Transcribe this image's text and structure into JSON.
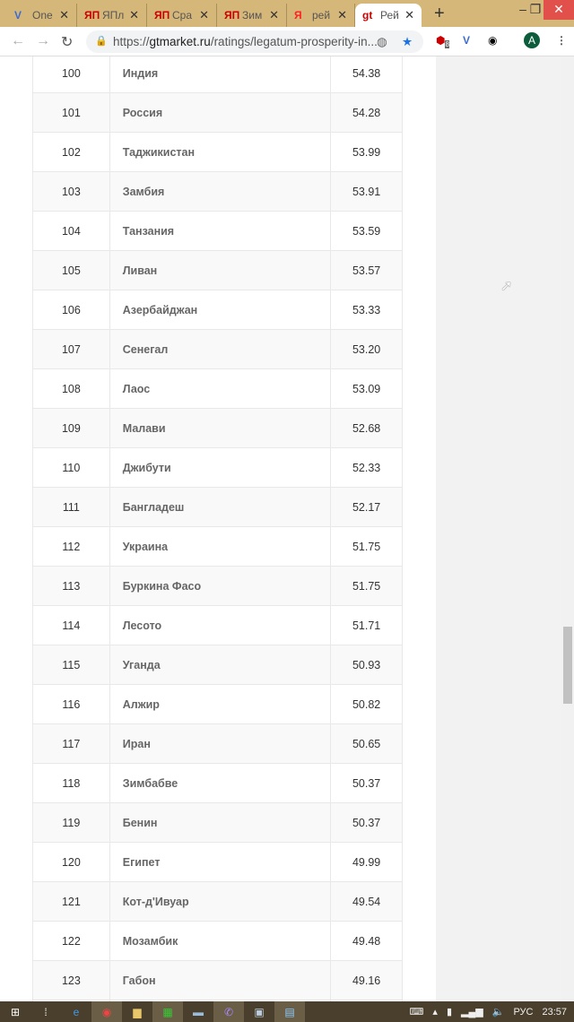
{
  "browser": {
    "tabs": [
      {
        "label": "One",
        "icon": "vivaldi-v-icon",
        "color": "#3b6cd4"
      },
      {
        "label": "ЯПл",
        "icon": "yandex-market-icon",
        "color": "#c00"
      },
      {
        "label": "Сра",
        "icon": "yandex-market-icon",
        "color": "#c00"
      },
      {
        "label": "Зим",
        "icon": "yandex-market-icon",
        "color": "#c00"
      },
      {
        "label": "рей",
        "icon": "yandex-icon",
        "color": "#f22"
      },
      {
        "label": "Рей",
        "icon": "gt-icon",
        "color": "#c00",
        "active": true
      }
    ],
    "url_prefix": "https://",
    "url_domain": "gtmarket.ru",
    "url_path": "/ratings/legatum-prosperity-in...",
    "adblock_count": "8",
    "profile_initial": "A"
  },
  "table": {
    "rows": [
      {
        "rank": "100",
        "country": "Индия",
        "score": "54.38"
      },
      {
        "rank": "101",
        "country": "Россия",
        "score": "54.28"
      },
      {
        "rank": "102",
        "country": "Таджикистан",
        "score": "53.99"
      },
      {
        "rank": "103",
        "country": "Замбия",
        "score": "53.91"
      },
      {
        "rank": "104",
        "country": "Танзания",
        "score": "53.59"
      },
      {
        "rank": "105",
        "country": "Ливан",
        "score": "53.57"
      },
      {
        "rank": "106",
        "country": "Азербайджан",
        "score": "53.33"
      },
      {
        "rank": "107",
        "country": "Сенегал",
        "score": "53.20"
      },
      {
        "rank": "108",
        "country": "Лаос",
        "score": "53.09"
      },
      {
        "rank": "109",
        "country": "Малави",
        "score": "52.68"
      },
      {
        "rank": "110",
        "country": "Джибути",
        "score": "52.33"
      },
      {
        "rank": "111",
        "country": "Бангладеш",
        "score": "52.17"
      },
      {
        "rank": "112",
        "country": "Украина",
        "score": "51.75"
      },
      {
        "rank": "113",
        "country": "Буркина Фасо",
        "score": "51.75"
      },
      {
        "rank": "114",
        "country": "Лесото",
        "score": "51.71"
      },
      {
        "rank": "115",
        "country": "Уганда",
        "score": "50.93"
      },
      {
        "rank": "116",
        "country": "Алжир",
        "score": "50.82"
      },
      {
        "rank": "117",
        "country": "Иран",
        "score": "50.65"
      },
      {
        "rank": "118",
        "country": "Зимбабве",
        "score": "50.37"
      },
      {
        "rank": "119",
        "country": "Бенин",
        "score": "50.37"
      },
      {
        "rank": "120",
        "country": "Египет",
        "score": "49.99"
      },
      {
        "rank": "121",
        "country": "Кот-д'Ивуар",
        "score": "49.54"
      },
      {
        "rank": "122",
        "country": "Мозамбик",
        "score": "49.48"
      },
      {
        "rank": "123",
        "country": "Габон",
        "score": "49.16"
      },
      {
        "rank": "",
        "country": "",
        "score": ""
      }
    ]
  },
  "taskbar": {
    "language": "РУС",
    "time": "23:57"
  }
}
